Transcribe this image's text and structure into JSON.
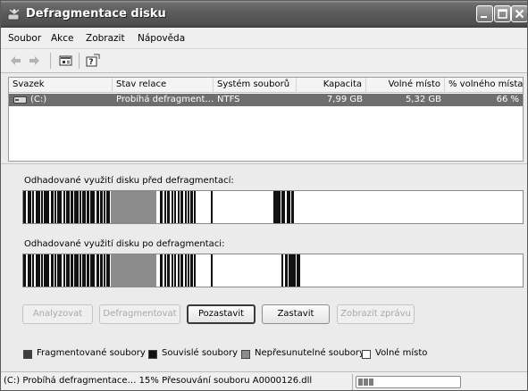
{
  "window": {
    "title": "Defragmentace disku",
    "icon": "defrag-app-icon"
  },
  "menu": [
    "Soubor",
    "Akce",
    "Zobrazit",
    "Nápověda"
  ],
  "toolbar": {
    "icons": [
      "back-arrow-icon",
      "forward-arrow-icon",
      "properties-icon",
      "help-icon"
    ]
  },
  "volumes": {
    "columns": [
      "Svazek",
      "Stav relace",
      "Systém souborů",
      "Kapacita",
      "Volné místo",
      "% volného místa"
    ],
    "rows": [
      {
        "volume": "(C:)",
        "status": "Probíhá defragment…",
        "filesystem": "NTFS",
        "capacity": "7,99 GB",
        "free": "5,32 GB",
        "free_percent": "66 %",
        "selected": true
      }
    ]
  },
  "analysis": {
    "before_label": "Odhadované využití disku před defragmentací:",
    "after_label": "Odhadované využití disku po defragmentaci:"
  },
  "buttons": {
    "analyze": "Analyzovat",
    "defragment": "Defragmentovat",
    "pause": "Pozastavit",
    "stop": "Zastavit",
    "report": "Zobrazit zprávu"
  },
  "legend": [
    {
      "label": "Fragmentované soubory",
      "color": "#3c3c3c"
    },
    {
      "label": "Souvislé soubory",
      "color": "#111111"
    },
    {
      "label": "Nepřesunutelné soubory",
      "color": "#8c8c8c"
    },
    {
      "label": "Volné místo",
      "color": "#ffffff"
    }
  ],
  "status": {
    "text": "(C:) Probíhá defragmentace… 15%  Přesouvání souboru A0000126.dll",
    "progress_fraction": 0.15
  },
  "colors": {
    "fragmented": "#3c3c3c",
    "contiguous": "#111111",
    "unmovable": "#8c8c8c",
    "free": "#ffffff",
    "selection": "#6e6e6e"
  }
}
